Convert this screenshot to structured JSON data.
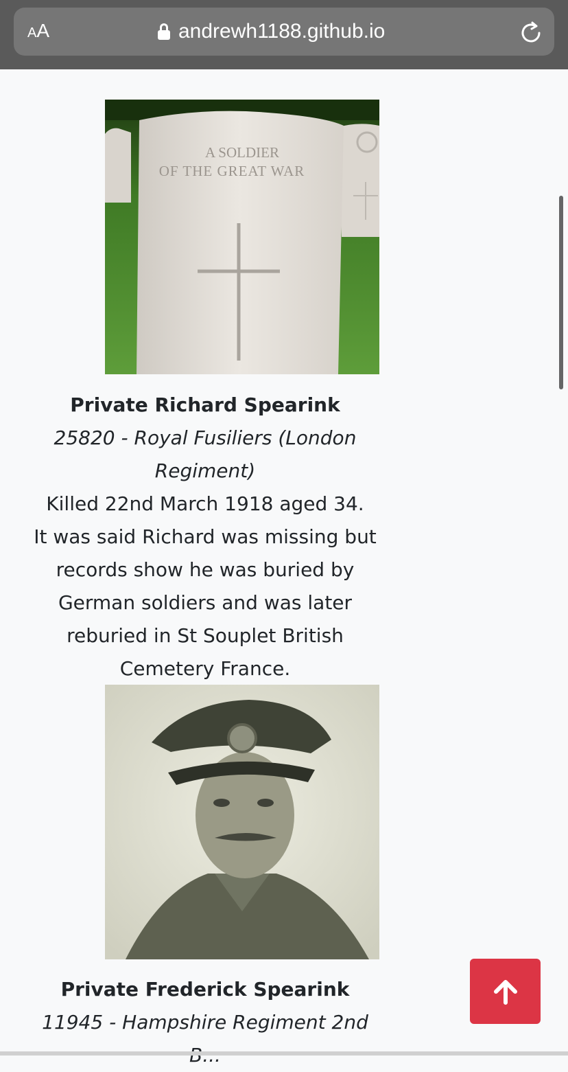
{
  "browser": {
    "text_size_small": "A",
    "text_size_large": "A",
    "address": "andrewh1188.github.io"
  },
  "soldiers": [
    {
      "image_inscription_line1": "A SOLDIER",
      "image_inscription_line2": "OF THE GREAT WAR",
      "name": "Private Richard Spearink",
      "unit": "25820 - Royal Fusiliers (London Regiment)",
      "killed": "Killed 22nd March 1918 aged 34.",
      "story": "It was said Richard was missing but records show he was buried by German soldiers and was later reburied in St Souplet British Cemetery France."
    },
    {
      "name": "Private Frederick Spearink",
      "unit": "11945 - Hampshire Regiment 2nd B..."
    }
  ],
  "icons": {
    "lock": "lock-icon",
    "reload": "reload-icon",
    "back_to_top": "arrow-up-icon"
  },
  "colors": {
    "back_to_top_bg": "#dc3545",
    "page_bg": "#f8f9fa",
    "browser_bar": "#5a5a5a"
  }
}
